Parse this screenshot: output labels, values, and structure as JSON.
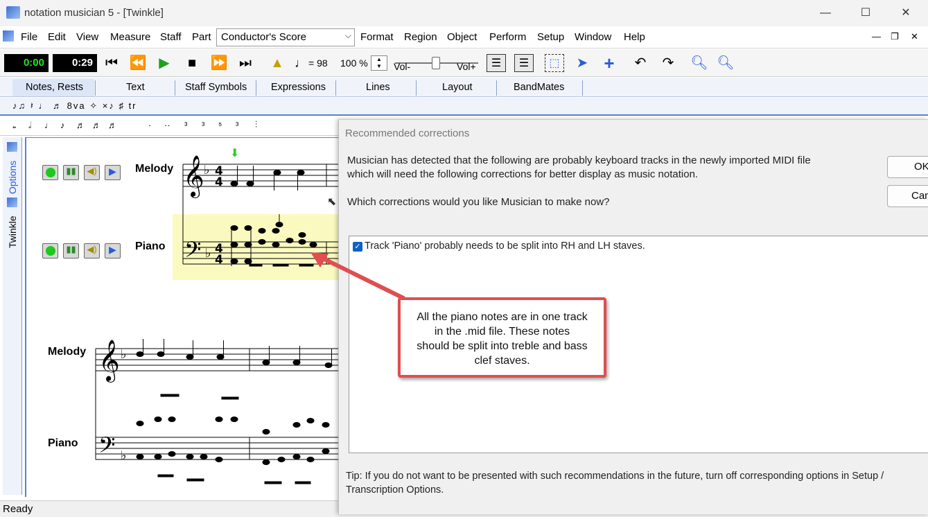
{
  "window": {
    "title": "notation musician 5 - [Twinkle]",
    "minimize": "—",
    "maximize": "☐",
    "close": "✕"
  },
  "menu": {
    "items": [
      "File",
      "Edit",
      "View",
      "Measure",
      "Staff",
      "Part"
    ],
    "items2": [
      "Format",
      "Region",
      "Object",
      "Perform",
      "Setup",
      "Window",
      "Help"
    ],
    "score_select": "Conductor's Score",
    "mdi": [
      "—",
      "❐",
      "✕"
    ]
  },
  "toolbar": {
    "time_current": "0:00",
    "time_total": "0:29",
    "tempo": "= 98",
    "zoom": "100 %",
    "vol_minus": "Vol-",
    "vol_plus": "Vol+"
  },
  "palette_tabs": [
    "Notes, Rests",
    "Text",
    "Staff Symbols",
    "Expressions",
    "Lines",
    "Layout",
    "BandMates"
  ],
  "palette_row1": "♪♫ 𝄽 ♩ ♬ 8va ✧ ×♪ ♯ tr",
  "palette_row2": [
    "𝅝",
    "𝅗𝅥",
    "♩",
    "♪",
    "♬",
    "♬",
    "♬",
    "·",
    "··",
    "³",
    "³",
    "⁵",
    "³"
  ],
  "sidebar": {
    "tab1": "Options",
    "tab2": "Twinkle"
  },
  "score": {
    "staff1": "Melody",
    "staff2": "Piano",
    "staff3": "Melody",
    "staff4": "Piano",
    "time_sig_top": "4",
    "time_sig_bottom": "4"
  },
  "dialog": {
    "title": "Recommended corrections",
    "message1": "Musician has detected that the following are probably keyboard tracks in the newly imported MIDI file",
    "message2": "which will need the following corrections for better display as music notation.",
    "question": "Which corrections would you like Musician to make now?",
    "ok": "OK",
    "cancel": "Cancel",
    "item1": "Track 'Piano' probably needs to be split into RH and LH staves.",
    "tip1": "Tip: If you do not want to be presented with such recommendations in the future, turn off corresponding options in Setup /",
    "tip2": "Transcription Options."
  },
  "callout": {
    "line1": "All the piano notes are in one track",
    "line2": "in the .mid file.  These notes",
    "line3": "should be split into treble and bass",
    "line4": "clef staves."
  },
  "status": {
    "text": "Ready"
  },
  "colors": {
    "accent": "#5a82c8",
    "callout_border": "#e04e50",
    "checkbox": "#0d62c6",
    "piano_highlight": "#fafac0"
  }
}
